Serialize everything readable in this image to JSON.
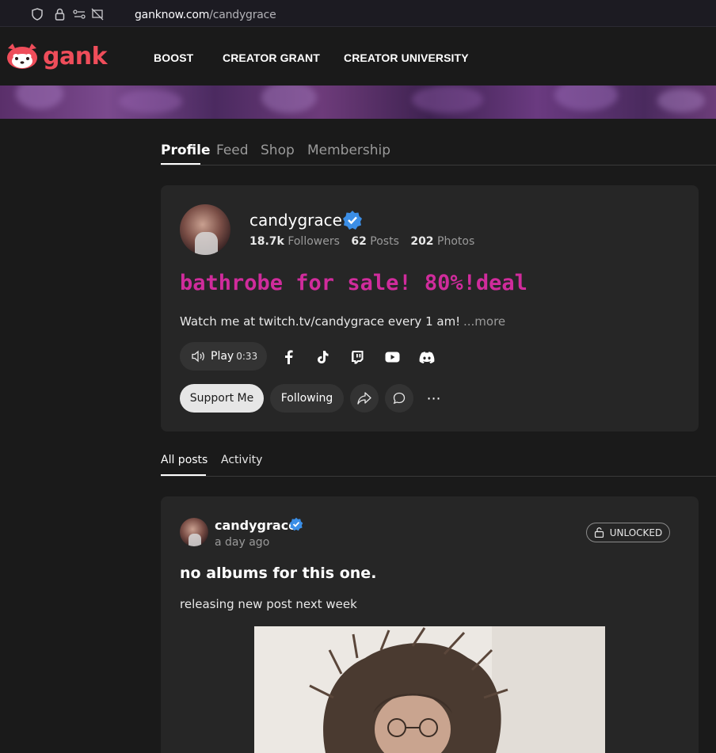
{
  "browser": {
    "url_domain": "ganknow.com",
    "url_path": "/candygrace"
  },
  "header": {
    "logo_text": "gank",
    "nav": [
      "BOOST",
      "CREATOR GRANT",
      "CREATOR UNIVERSITY"
    ]
  },
  "tabs": [
    "Profile",
    "Feed",
    "Shop",
    "Membership"
  ],
  "profile": {
    "username": "candygrace",
    "followers_count": "18.7k",
    "followers_label": "Followers",
    "posts_count": "62",
    "posts_label": "Posts",
    "photos_count": "202",
    "photos_label": "Photos",
    "headline": "bathrobe for sale! 80%!deal",
    "bio": "Watch me at twitch.tv/candygrace every 1 am!",
    "more_label": "...more",
    "play_label": "Play",
    "play_duration": "0:33",
    "support_label": "Support Me",
    "following_label": "Following",
    "more_icon": "⋯",
    "social_icons": [
      "facebook-icon",
      "tiktok-icon",
      "twitch-icon",
      "youtube-icon",
      "discord-icon"
    ]
  },
  "sub_tabs": [
    "All posts",
    "Activity"
  ],
  "post": {
    "username": "candygrace",
    "time": "a day ago",
    "badge": "UNLOCKED",
    "title": "no albums for this one.",
    "body": "releasing new post next week"
  },
  "colors": {
    "brand": "#ef4d5a",
    "headline": "#d02c9c",
    "verified": "#3b8ee6"
  }
}
